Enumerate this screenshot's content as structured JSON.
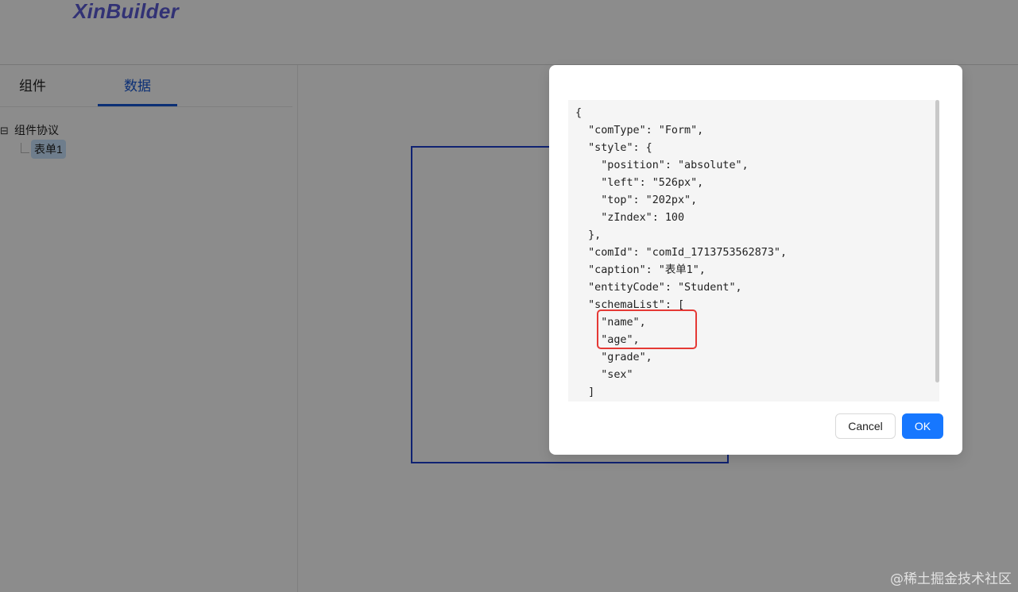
{
  "app": {
    "logo": "XinBuilder",
    "tabs": [
      {
        "label": "组件",
        "active": false
      },
      {
        "label": "数据",
        "active": true
      }
    ],
    "tree": {
      "toggle": "⊟",
      "root_label": "组件协议",
      "leaf_label": "表单1"
    }
  },
  "modal": {
    "code_lines": [
      "{",
      "  \"comType\": \"Form\",",
      "  \"style\": {",
      "    \"position\": \"absolute\",",
      "    \"left\": \"526px\",",
      "    \"top\": \"202px\",",
      "    \"zIndex\": 100",
      "  },",
      "  \"comId\": \"comId_1713753562873\",",
      "  \"caption\": \"表单1\",",
      "  \"entityCode\": \"Student\",",
      "  \"schemaList\": [",
      "    \"name\",",
      "    \"age\",",
      "    \"grade\",",
      "    \"sex\"",
      "  ]"
    ],
    "cancel_label": "Cancel",
    "ok_label": "OK"
  },
  "watermark": "@稀土掘金技术社区",
  "colors": {
    "accent": "#1677ff",
    "active_tab": "#1456d6",
    "highlight": "#e53935",
    "form_frame": "#1d3fcf"
  }
}
